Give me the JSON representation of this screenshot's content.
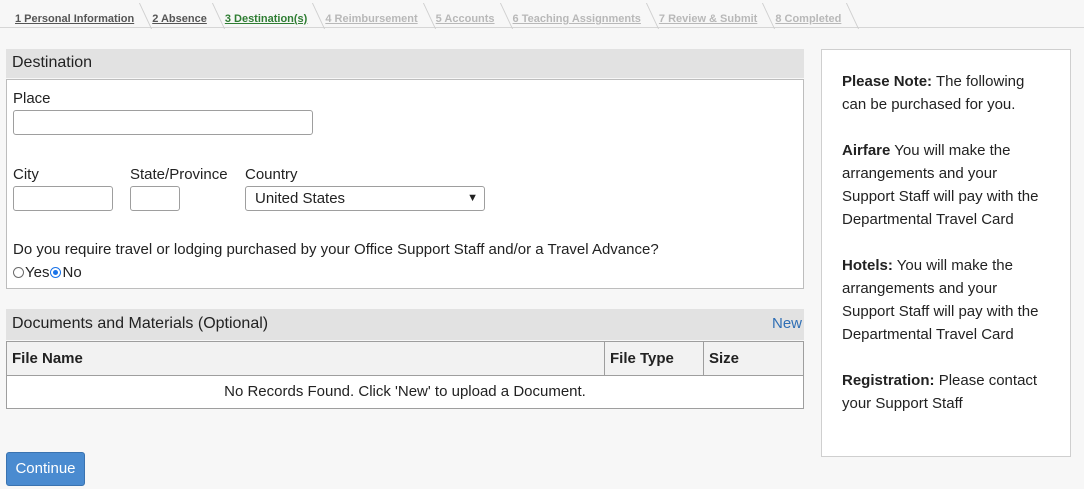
{
  "steps": [
    {
      "label": "1 Personal Information",
      "state": "done"
    },
    {
      "label": "2 Absence",
      "state": "done"
    },
    {
      "label": "3 Destination(s)",
      "state": "active"
    },
    {
      "label": "4 Reimbursement",
      "state": "pending"
    },
    {
      "label": "5 Accounts",
      "state": "pending"
    },
    {
      "label": "6 Teaching Assignments",
      "state": "pending"
    },
    {
      "label": "7 Review & Submit",
      "state": "pending"
    },
    {
      "label": "8 Completed",
      "state": "pending"
    }
  ],
  "destination": {
    "title": "Destination",
    "place_label": "Place",
    "place_value": "",
    "city_label": "City",
    "city_value": "",
    "state_label": "State/Province",
    "state_value": "",
    "country_label": "Country",
    "country_value": "United States",
    "question": "Do you require travel or lodging purchased by your Office Support Staff and/or a Travel Advance?",
    "yes_label": "Yes",
    "no_label": "No",
    "selected": "No"
  },
  "documents": {
    "title": "Documents and Materials (Optional)",
    "new_label": "New",
    "columns": [
      "File Name",
      "File Type",
      "Size"
    ],
    "empty_message": "No Records Found. Click 'New' to upload a Document."
  },
  "continue_label": "Continue",
  "note": {
    "intro_bold": "Please Note:",
    "intro_text": "The following can be purchased for you.",
    "airfare_bold": "Airfare",
    "airfare_text": "You will make the arrangements and your Support Staff will pay with the Departmental Travel Card",
    "hotels_bold": "Hotels:",
    "hotels_text": "You will make the arrangements and your Support Staff will pay with the Departmental Travel Card",
    "registration_bold": "Registration:",
    "registration_text": "Please contact your Support Staff"
  },
  "colors": {
    "active_step": "#2e7d32",
    "link": "#2f6fb5",
    "primary_button": "#4a8bd0"
  }
}
